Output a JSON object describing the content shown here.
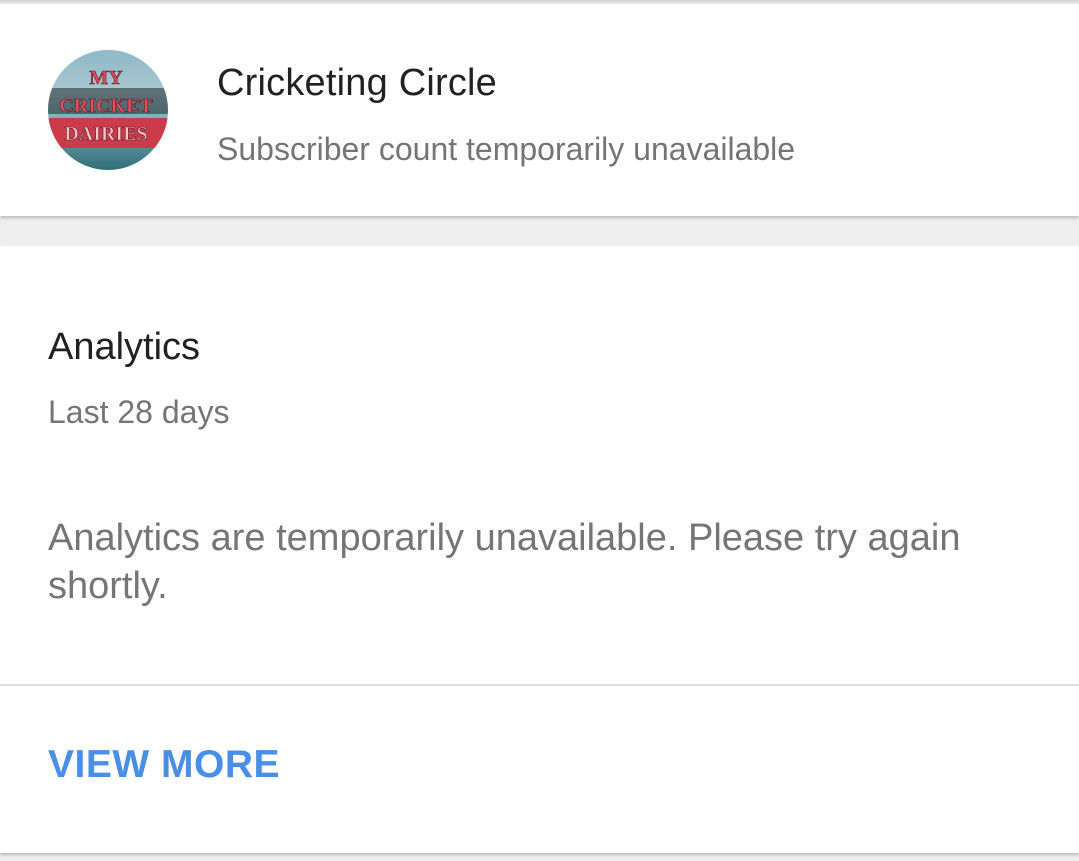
{
  "channel": {
    "name": "Cricketing Circle",
    "subscriber_text": "Subscriber count temporarily unavailable",
    "avatar_text": [
      "MY",
      "CRICKET",
      "DAIRIES"
    ]
  },
  "analytics": {
    "title": "Analytics",
    "period": "Last 28 days",
    "message": "Analytics are temporarily unavailable. Please try again shortly.",
    "view_more_label": "VIEW MORE"
  },
  "colors": {
    "primary_text": "#212121",
    "secondary_text": "#757575",
    "link": "#4a8fe7",
    "background": "#eeeeee",
    "card": "#ffffff"
  }
}
